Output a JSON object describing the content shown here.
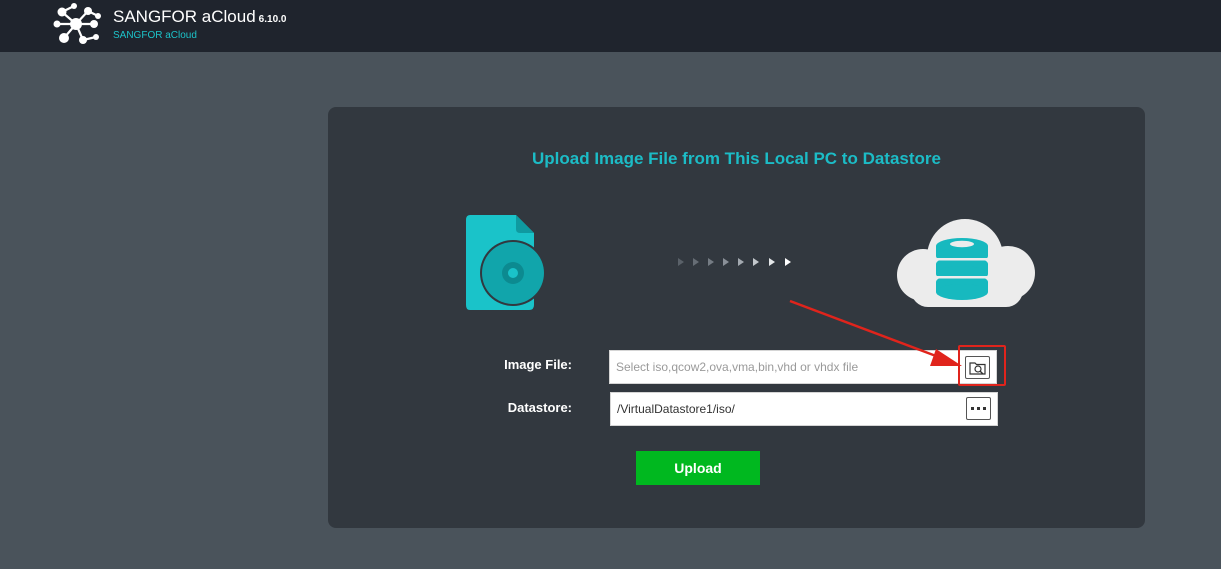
{
  "header": {
    "product_name": "SANGFOR aCloud",
    "version": "6.10.0",
    "subtitle": "SANGFOR aCloud"
  },
  "dialog": {
    "title": "Upload Image File from This Local PC to Datastore",
    "image_file": {
      "label": "Image File:",
      "placeholder": "Select iso,qcow2,ova,vma,bin,vhd or vhdx file",
      "value": "",
      "browse_icon": "folder-search-icon"
    },
    "datastore": {
      "label": "Datastore:",
      "value": "/VirtualDatastore1/iso/",
      "more_icon": "more-dots-icon"
    },
    "upload_label": "Upload"
  },
  "colors": {
    "accent": "#1cbcc6",
    "upload_button": "#00b81f",
    "highlight": "#e0241c",
    "panel": "#32383f",
    "topbar": "#1f242d"
  }
}
